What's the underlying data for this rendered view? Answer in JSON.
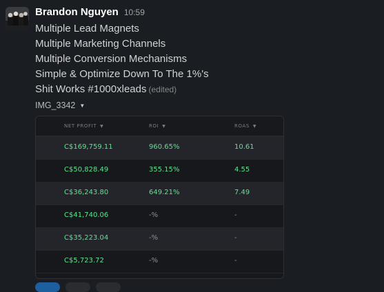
{
  "message": {
    "author": "Brandon Nguyen",
    "time": "10:59",
    "lines": [
      "Multiple Lead Magnets",
      "Multiple Marketing Channels",
      "Multiple Conversion Mechanisms",
      "Simple & Optimize Down To The 1%'s",
      "Shit Works #1000xleads"
    ],
    "edited": "(edited)"
  },
  "attachment": {
    "filename": "IMG_3342",
    "table": {
      "headers": [
        "NET PROFIT",
        "ROI",
        "ROAS"
      ],
      "rows": [
        [
          "C$169,759.11",
          "960.65%",
          "10.61"
        ],
        [
          "C$50,828.49",
          "355.15%",
          "4.55"
        ],
        [
          "C$36,243.80",
          "649.21%",
          "7.49"
        ],
        [
          "C$41,740.06",
          "-%",
          "-"
        ],
        [
          "C$35,223.04",
          "-%",
          "-"
        ],
        [
          "C$5,723.72",
          "-%",
          "-"
        ]
      ]
    }
  },
  "colors": {
    "background": "#1a1d21",
    "profit_green": "#5fe38c",
    "muted": "#8d9096"
  }
}
